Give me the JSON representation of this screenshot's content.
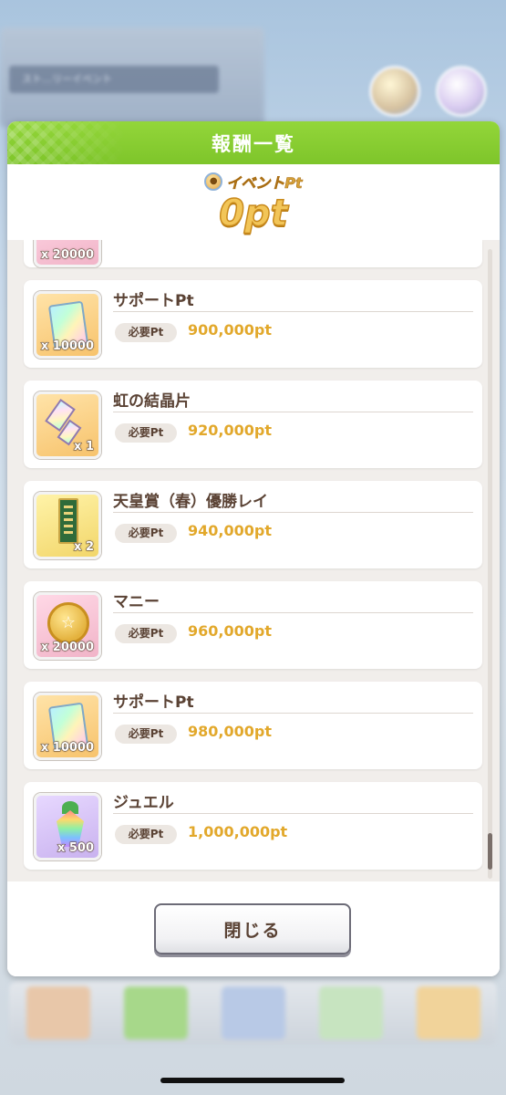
{
  "background": {
    "banner_text": "スト…リーイベント"
  },
  "modal": {
    "title": "報酬一覧",
    "points_label": "イベントPt",
    "points_value": "0pt",
    "partial_item_quantity": "x 20000",
    "required_label": "必要Pt",
    "items": [
      {
        "name": "サポートPt",
        "quantity": "x 10000",
        "required": "900,000pt",
        "icon": "support-pt-card-icon",
        "color": "orange"
      },
      {
        "name": "虹の結晶片",
        "quantity": "x 1",
        "required": "920,000pt",
        "icon": "rainbow-crystal-icon",
        "color": "orange"
      },
      {
        "name": "天皇賞（春）優勝レイ",
        "quantity": "x 2",
        "required": "940,000pt",
        "icon": "victory-lei-icon",
        "color": "yellow"
      },
      {
        "name": "マニー",
        "quantity": "x 20000",
        "required": "960,000pt",
        "icon": "money-coin-icon",
        "color": "pink"
      },
      {
        "name": "サポートPt",
        "quantity": "x 10000",
        "required": "980,000pt",
        "icon": "support-pt-card-icon",
        "color": "orange"
      },
      {
        "name": "ジュエル",
        "quantity": "x 500",
        "required": "1,000,000pt",
        "icon": "jewel-icon",
        "color": "purple"
      }
    ],
    "close_label": "閉じる"
  },
  "colors": {
    "header_green": "#86cc30",
    "required_value": "#e2a82b",
    "item_name": "#5a4234"
  }
}
